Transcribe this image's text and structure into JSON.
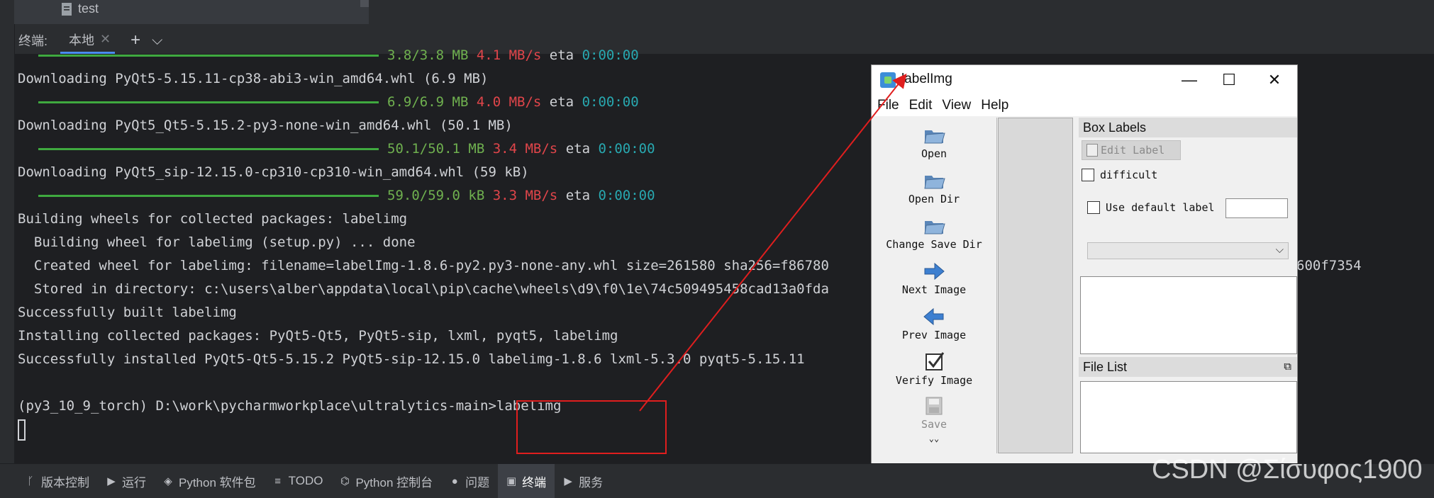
{
  "project_tree": {
    "item": "test"
  },
  "terminal_tabs": {
    "label": "终端:",
    "active": "本地",
    "add_icon": "+",
    "more_icon": "⌄"
  },
  "terminal": {
    "lines": [
      {
        "progress": true,
        "size": "3.8/3.8 MB",
        "speed": "4.1 MB/s",
        "eta_label": "eta",
        "eta": "0:00:00"
      },
      {
        "text": "Downloading PyQt5-5.15.11-cp38-abi3-win_amd64.whl (6.9 MB)"
      },
      {
        "progress": true,
        "size": "6.9/6.9 MB",
        "speed": "4.0 MB/s",
        "eta_label": "eta",
        "eta": "0:00:00"
      },
      {
        "text": "Downloading PyQt5_Qt5-5.15.2-py3-none-win_amd64.whl (50.1 MB)"
      },
      {
        "progress": true,
        "size": "50.1/50.1 MB",
        "speed": "3.4 MB/s",
        "eta_label": "eta",
        "eta": "0:00:00"
      },
      {
        "text": "Downloading PyQt5_sip-12.15.0-cp310-cp310-win_amd64.whl (59 kB)"
      },
      {
        "progress": true,
        "size": "59.0/59.0 kB",
        "speed": "3.3 MB/s",
        "eta_label": "eta",
        "eta": "0:00:00"
      },
      {
        "text": "Building wheels for collected packages: labelimg"
      },
      {
        "text": "  Building wheel for labelimg (setup.py) ... done"
      },
      {
        "text": "  Created wheel for labelimg: filename=labelImg-1.8.6-py2.py3-none-any.whl size=261580 sha256=f86780",
        "tail": "600f7354"
      },
      {
        "text": "  Stored in directory: c:\\users\\alber\\appdata\\local\\pip\\cache\\wheels\\d9\\f0\\1e\\74c509495458cad13a0fda"
      },
      {
        "text": "Successfully built labelimg"
      },
      {
        "text": "Installing collected packages: PyQt5-Qt5, PyQt5-sip, lxml, pyqt5, labelimg"
      },
      {
        "text": "Successfully installed PyQt5-Qt5-5.15.2 PyQt5-sip-12.15.0 labelimg-1.8.6 lxml-5.3.0 pyqt5-5.15.11"
      },
      {
        "text": ""
      },
      {
        "text": "(py3_10_9_torch) D:\\work\\pycharmworkplace\\ultralytics-main>labelimg"
      }
    ]
  },
  "labelimg_window": {
    "title": "labelImg",
    "controls": {
      "minimize": "—",
      "maximize": "☐",
      "close": "✕"
    },
    "menu": [
      "File",
      "Edit",
      "View",
      "Help"
    ],
    "tools": [
      {
        "label": "Open",
        "icon": "folder-icon",
        "enabled": true
      },
      {
        "label": "Open Dir",
        "icon": "folder-icon",
        "enabled": true
      },
      {
        "label": "Change Save Dir",
        "icon": "folder-icon",
        "enabled": true
      },
      {
        "label": "Next Image",
        "icon": "arrow-right-icon",
        "enabled": true
      },
      {
        "label": "Prev Image",
        "icon": "arrow-left-icon",
        "enabled": true
      },
      {
        "label": "Verify Image",
        "icon": "checkmark-icon",
        "enabled": true
      },
      {
        "label": "Save",
        "icon": "save-icon",
        "enabled": false
      }
    ],
    "more": "⌄⌄",
    "box_labels": {
      "title": "Box Labels",
      "edit_label": "Edit Label",
      "difficult": "difficult",
      "use_default_label": "Use default label",
      "default_label_value": ""
    },
    "file_list": {
      "title": "File List"
    }
  },
  "status_bar": {
    "items": [
      {
        "label": "版本控制",
        "icon": "branch-icon"
      },
      {
        "label": "运行",
        "icon": "play-icon"
      },
      {
        "label": "Python 软件包",
        "icon": "layers-icon"
      },
      {
        "label": "TODO",
        "icon": "list-icon"
      },
      {
        "label": "Python 控制台",
        "icon": "python-icon"
      },
      {
        "label": "问题",
        "icon": "info-icon"
      },
      {
        "label": "终端",
        "icon": "terminal-icon",
        "active": true
      },
      {
        "label": "服务",
        "icon": "services-icon"
      }
    ]
  },
  "watermark": "CSDN @Σίσυφος1900",
  "colors": {
    "progress_green": "#3fa93f",
    "speed_red": "#e0454a",
    "eta_cyan": "#28a8b0",
    "annotation_red": "#e01e1e"
  }
}
